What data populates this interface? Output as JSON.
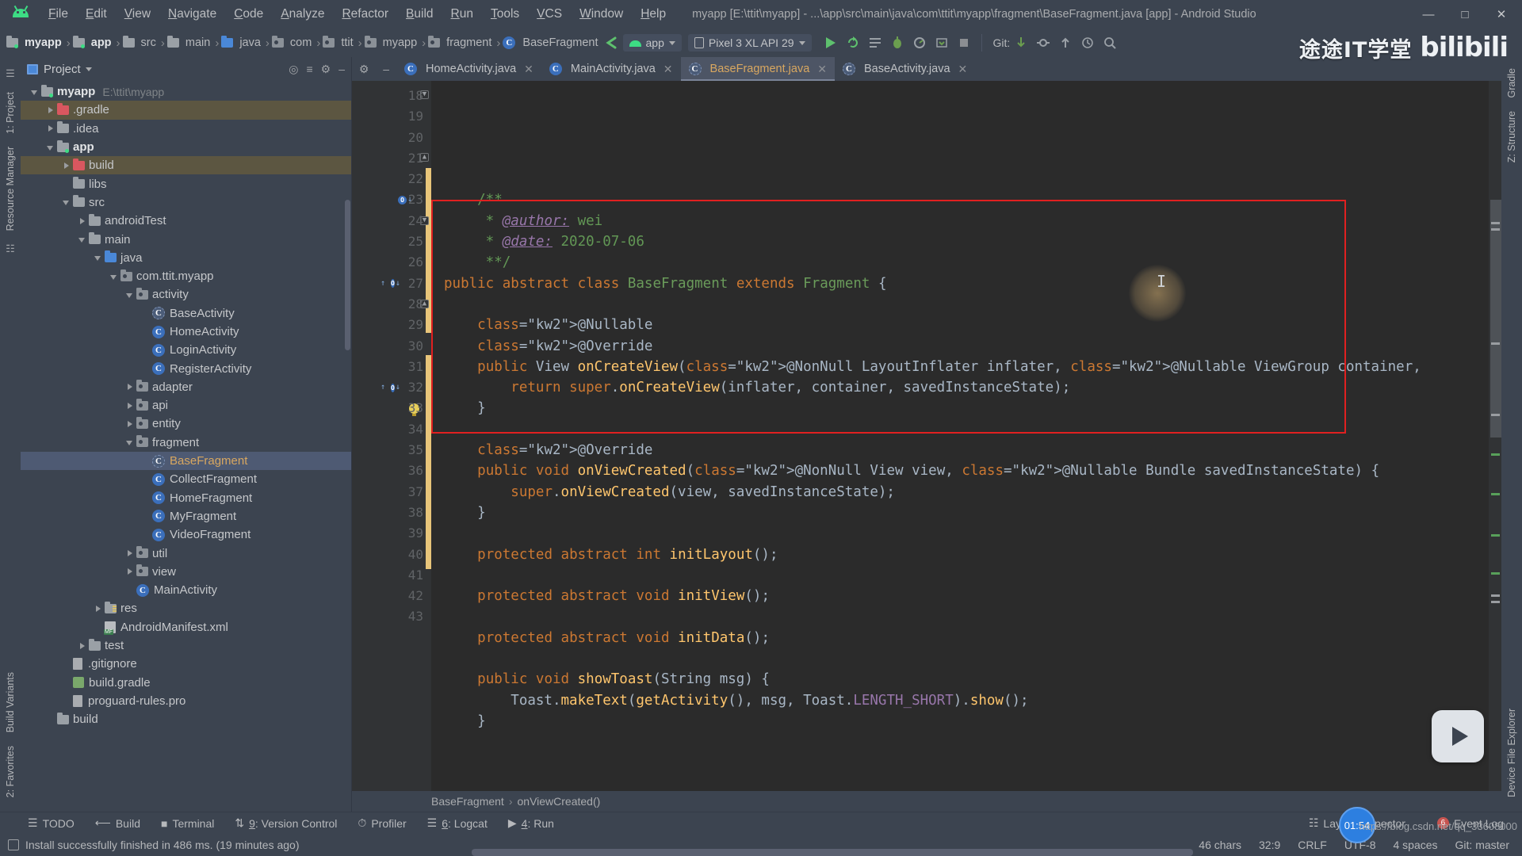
{
  "window": {
    "title": "myapp [E:\\ttit\\myapp] - ...\\app\\src\\main\\java\\com\\ttit\\myapp\\fragment\\BaseFragment.java [app] - Android Studio",
    "minimize": "—",
    "maximize": "□",
    "close": "✕"
  },
  "menu": [
    {
      "label": "File"
    },
    {
      "label": "Edit"
    },
    {
      "label": "View"
    },
    {
      "label": "Navigate"
    },
    {
      "label": "Code"
    },
    {
      "label": "Analyze"
    },
    {
      "label": "Refactor"
    },
    {
      "label": "Build"
    },
    {
      "label": "Run"
    },
    {
      "label": "Tools"
    },
    {
      "label": "VCS"
    },
    {
      "label": "Window"
    },
    {
      "label": "Help"
    }
  ],
  "breadcrumbs": [
    {
      "label": "myapp",
      "icon": "module-icon",
      "bold": true
    },
    {
      "label": "app",
      "icon": "module-icon",
      "bold": true
    },
    {
      "label": "src",
      "icon": "folder-icon",
      "bold": false
    },
    {
      "label": "main",
      "icon": "folder-icon",
      "bold": false
    },
    {
      "label": "java",
      "icon": "source-folder-icon",
      "bold": false
    },
    {
      "label": "com",
      "icon": "package-icon",
      "bold": false
    },
    {
      "label": "ttit",
      "icon": "package-icon",
      "bold": false
    },
    {
      "label": "myapp",
      "icon": "package-icon",
      "bold": false
    },
    {
      "label": "fragment",
      "icon": "package-icon",
      "bold": false
    },
    {
      "label": "BaseFragment",
      "icon": "class-icon",
      "bold": false
    }
  ],
  "toolbar": {
    "run_config": "app",
    "device": "Pixel 3 XL API 29",
    "git_label": "Git:",
    "run_tooltip": "Run",
    "debug_tooltip": "Debug"
  },
  "watermark": {
    "cn_text": "途途IT学堂",
    "bili_text": "bilibili"
  },
  "left_rail": [
    {
      "label": "1: Project"
    },
    {
      "label": "Resource Manager"
    },
    {
      "label": "Build Variants"
    },
    {
      "label": "2: Favorites"
    }
  ],
  "right_rail": [
    {
      "label": "Gradle"
    },
    {
      "label": "Z: Structure"
    },
    {
      "label": "Device File Explorer"
    }
  ],
  "project": {
    "title": "Project",
    "tree": [
      {
        "depth": 0,
        "label": "myapp",
        "path": "E:\\ttit\\myapp",
        "icon": "module-icon",
        "arrow": "open",
        "bold": true,
        "state": "normal"
      },
      {
        "depth": 1,
        "label": ".gradle",
        "icon": "folder-red-icon",
        "arrow": "closed",
        "state": "highlight"
      },
      {
        "depth": 1,
        "label": ".idea",
        "icon": "folder-icon",
        "arrow": "closed",
        "state": "normal"
      },
      {
        "depth": 1,
        "label": "app",
        "icon": "module-icon",
        "arrow": "open",
        "bold": true,
        "state": "normal"
      },
      {
        "depth": 2,
        "label": "build",
        "icon": "folder-red-icon",
        "arrow": "closed",
        "state": "highlight"
      },
      {
        "depth": 2,
        "label": "libs",
        "icon": "folder-icon",
        "arrow": "none",
        "state": "normal"
      },
      {
        "depth": 2,
        "label": "src",
        "icon": "folder-icon",
        "arrow": "open",
        "state": "normal"
      },
      {
        "depth": 3,
        "label": "androidTest",
        "icon": "folder-icon",
        "arrow": "closed",
        "state": "normal"
      },
      {
        "depth": 3,
        "label": "main",
        "icon": "folder-icon",
        "arrow": "open",
        "state": "normal"
      },
      {
        "depth": 4,
        "label": "java",
        "icon": "source-folder-icon",
        "arrow": "open",
        "state": "normal"
      },
      {
        "depth": 5,
        "label": "com.ttit.myapp",
        "icon": "package-icon",
        "arrow": "open",
        "state": "normal"
      },
      {
        "depth": 6,
        "label": "activity",
        "icon": "package-icon",
        "arrow": "open",
        "state": "normal"
      },
      {
        "depth": 7,
        "label": "BaseActivity",
        "icon": "abstract-class-icon",
        "arrow": "none",
        "state": "normal"
      },
      {
        "depth": 7,
        "label": "HomeActivity",
        "icon": "class-icon",
        "arrow": "none",
        "state": "normal"
      },
      {
        "depth": 7,
        "label": "LoginActivity",
        "icon": "class-icon",
        "arrow": "none",
        "state": "normal"
      },
      {
        "depth": 7,
        "label": "RegisterActivity",
        "icon": "class-icon",
        "arrow": "none",
        "state": "normal"
      },
      {
        "depth": 6,
        "label": "adapter",
        "icon": "package-icon",
        "arrow": "closed",
        "state": "normal"
      },
      {
        "depth": 6,
        "label": "api",
        "icon": "package-icon",
        "arrow": "closed",
        "state": "normal"
      },
      {
        "depth": 6,
        "label": "entity",
        "icon": "package-icon",
        "arrow": "closed",
        "state": "normal"
      },
      {
        "depth": 6,
        "label": "fragment",
        "icon": "package-icon",
        "arrow": "open",
        "state": "normal"
      },
      {
        "depth": 7,
        "label": "BaseFragment",
        "icon": "abstract-class-icon",
        "arrow": "none",
        "state": "selected"
      },
      {
        "depth": 7,
        "label": "CollectFragment",
        "icon": "class-icon",
        "arrow": "none",
        "state": "normal"
      },
      {
        "depth": 7,
        "label": "HomeFragment",
        "icon": "class-icon",
        "arrow": "none",
        "state": "normal"
      },
      {
        "depth": 7,
        "label": "MyFragment",
        "icon": "class-icon",
        "arrow": "none",
        "state": "normal"
      },
      {
        "depth": 7,
        "label": "VideoFragment",
        "icon": "class-icon",
        "arrow": "none",
        "state": "normal"
      },
      {
        "depth": 6,
        "label": "util",
        "icon": "package-icon",
        "arrow": "closed",
        "state": "normal"
      },
      {
        "depth": 6,
        "label": "view",
        "icon": "package-icon",
        "arrow": "closed",
        "state": "normal"
      },
      {
        "depth": 6,
        "label": "MainActivity",
        "icon": "class-icon",
        "arrow": "none",
        "state": "normal"
      },
      {
        "depth": 4,
        "label": "res",
        "icon": "res-folder-icon",
        "arrow": "closed",
        "state": "normal"
      },
      {
        "depth": 4,
        "label": "AndroidManifest.xml",
        "icon": "manifest-icon",
        "arrow": "none",
        "state": "normal"
      },
      {
        "depth": 3,
        "label": "test",
        "icon": "folder-icon",
        "arrow": "closed",
        "state": "normal"
      },
      {
        "depth": 2,
        "label": ".gitignore",
        "icon": "file-icon",
        "arrow": "none",
        "state": "normal"
      },
      {
        "depth": 2,
        "label": "build.gradle",
        "icon": "gradle-icon",
        "arrow": "none",
        "state": "normal"
      },
      {
        "depth": 2,
        "label": "proguard-rules.pro",
        "icon": "file-icon",
        "arrow": "none",
        "state": "normal"
      },
      {
        "depth": 1,
        "label": "build",
        "icon": "folder-icon",
        "arrow": "none",
        "state": "normal"
      }
    ]
  },
  "editor": {
    "tabs": [
      {
        "label": "HomeActivity.java",
        "icon": "class-icon",
        "active": false,
        "close": "✕"
      },
      {
        "label": "MainActivity.java",
        "icon": "class-icon",
        "active": false,
        "close": "✕"
      },
      {
        "label": "BaseFragment.java",
        "icon": "abstract-class-icon",
        "active": true,
        "close": "✕"
      },
      {
        "label": "BaseActivity.java",
        "icon": "abstract-class-icon",
        "active": false,
        "close": "✕"
      }
    ],
    "first_line_number": 18,
    "lines": [
      {
        "n": 18,
        "text": "    /**"
      },
      {
        "n": 19,
        "text": "     * @author: wei"
      },
      {
        "n": 20,
        "text": "     * @date: 2020-07-06"
      },
      {
        "n": 21,
        "text": "     **/"
      },
      {
        "n": 22,
        "text": "public abstract class BaseFragment extends Fragment {"
      },
      {
        "n": 23,
        "text": ""
      },
      {
        "n": 24,
        "text": "    @Nullable"
      },
      {
        "n": 25,
        "text": "    @Override"
      },
      {
        "n": 26,
        "text": "    public View onCreateView(@NonNull LayoutInflater inflater, @Nullable ViewGroup container,"
      },
      {
        "n": 27,
        "text": "        return super.onCreateView(inflater, container, savedInstanceState);"
      },
      {
        "n": 28,
        "text": "    }"
      },
      {
        "n": 29,
        "text": ""
      },
      {
        "n": 30,
        "text": "    @Override"
      },
      {
        "n": 31,
        "text": "    public void onViewCreated(@NonNull View view, @Nullable Bundle savedInstanceState) {"
      },
      {
        "n": 32,
        "text": "        super.onViewCreated(view, savedInstanceState);"
      },
      {
        "n": 33,
        "text": "    }"
      },
      {
        "n": 34,
        "text": ""
      },
      {
        "n": 35,
        "text": "    protected abstract int initLayout();"
      },
      {
        "n": 36,
        "text": ""
      },
      {
        "n": 37,
        "text": "    protected abstract void initView();"
      },
      {
        "n": 38,
        "text": ""
      },
      {
        "n": 39,
        "text": "    protected abstract void initData();"
      },
      {
        "n": 40,
        "text": ""
      },
      {
        "n": 41,
        "text": "    public void showToast(String msg) {"
      },
      {
        "n": 42,
        "text": "        Toast.makeText(getActivity(), msg, Toast.LENGTH_SHORT).show();"
      },
      {
        "n": 43,
        "text": "    }"
      }
    ],
    "breadcrumb": [
      {
        "label": "BaseFragment"
      },
      {
        "label": "onViewCreated()"
      }
    ]
  },
  "tool_windows": [
    {
      "label": "TODO",
      "icon": "todo-icon",
      "mnemonic": ""
    },
    {
      "label": "Build",
      "icon": "build-icon",
      "mnemonic": ""
    },
    {
      "label": "Terminal",
      "icon": "terminal-icon",
      "mnemonic": ""
    },
    {
      "label": "9: Version Control",
      "icon": "vcs-icon",
      "mnemonic": "9"
    },
    {
      "label": "Profiler",
      "icon": "profiler-icon",
      "mnemonic": ""
    },
    {
      "label": "6: Logcat",
      "icon": "logcat-icon",
      "mnemonic": "6"
    },
    {
      "label": "4: Run",
      "icon": "run-icon",
      "mnemonic": "4"
    }
  ],
  "tool_windows_right": [
    {
      "label": "Layout Inspector",
      "icon": "layout-inspector-icon"
    },
    {
      "label": "Event Log",
      "icon": "event-log-icon",
      "badge": "6"
    }
  ],
  "status_bar": {
    "message": "Install successfully finished in 486 ms. (19 minutes ago)",
    "chars": "46 chars",
    "caret": "32:9",
    "line_sep": "CRLF",
    "encoding": "UTF-8",
    "indent": "4 spaces",
    "git_branch": "Git: master"
  },
  "overlays": {
    "timer": "01:54",
    "csdn": "https://blog.csdn.net/qq_33608000",
    "play_button": "play-icon"
  },
  "colors": {
    "accent_orange": "#d8a760",
    "panel_bg": "#3c4450",
    "editor_bg": "#2b2b2b",
    "gutter_bg": "#313335",
    "selection": "#4e5a73",
    "annotation_red": "#e02020",
    "android_green": "#3ddc84"
  }
}
